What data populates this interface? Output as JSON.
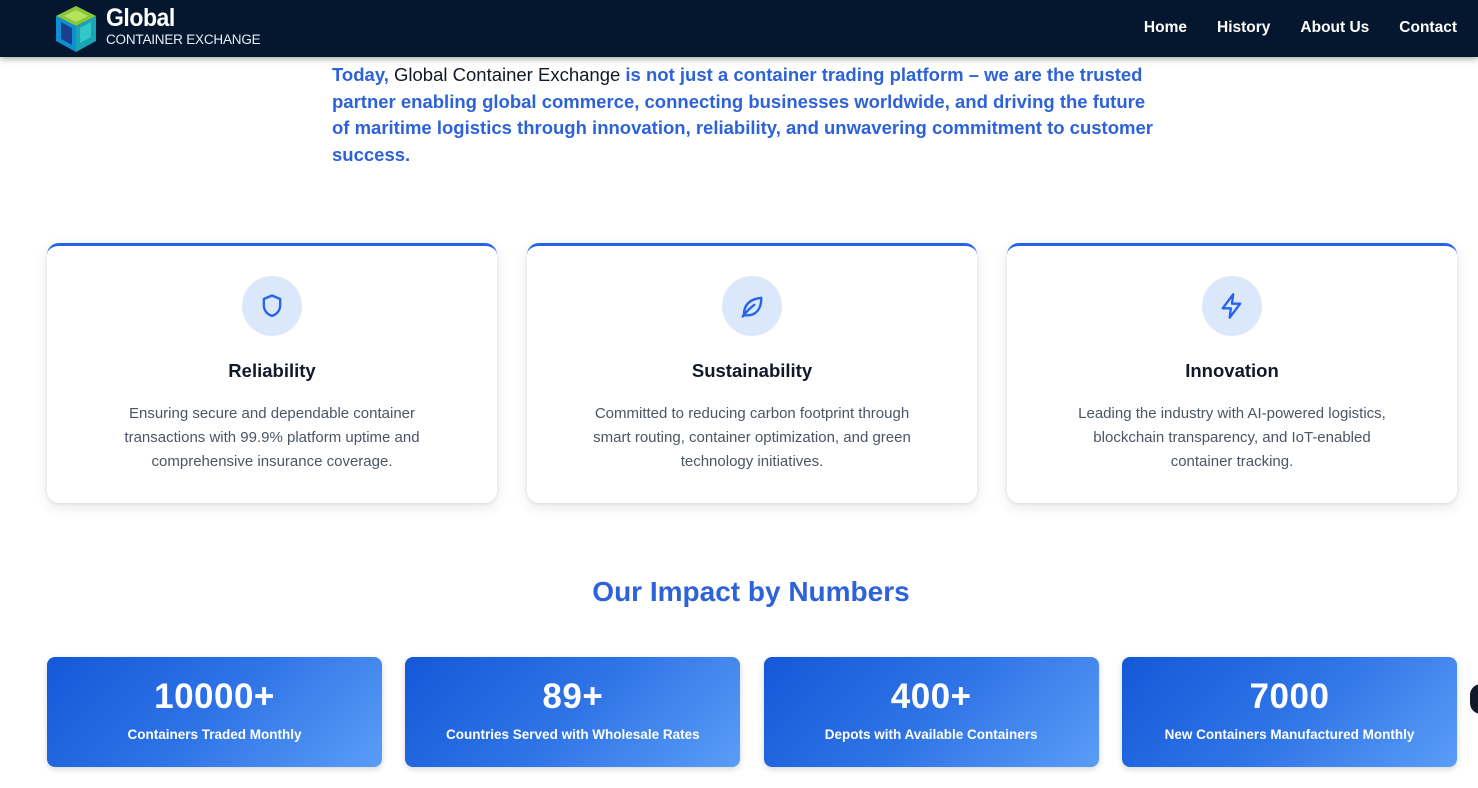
{
  "header": {
    "logo_title": "Global",
    "logo_subtitle": "CONTAINER EXCHANGE",
    "nav": [
      "Home",
      "History",
      "About Us",
      "Contact"
    ]
  },
  "intro": {
    "lead": "Today, ",
    "brand": "Global Container Exchange",
    "rest": " is not just a container trading platform – we are the trusted partner enabling global commerce, connecting businesses worldwide, and driving the future of maritime logistics through innovation, reliability, and unwavering commitment to customer success."
  },
  "values": [
    {
      "icon": "shield-icon",
      "title": "Reliability",
      "desc": "Ensuring secure and dependable container transactions with 99.9% platform uptime and comprehensive insurance coverage."
    },
    {
      "icon": "leaf-icon",
      "title": "Sustainability",
      "desc": "Committed to reducing carbon footprint through smart routing, container optimization, and green technology initiatives."
    },
    {
      "icon": "lightning-icon",
      "title": "Innovation",
      "desc": "Leading the industry with AI-powered logistics, blockchain transparency, and IoT-enabled container tracking."
    }
  ],
  "impact": {
    "title": "Our Impact by Numbers",
    "stats": [
      {
        "number": "10000+",
        "label": "Containers Traded Monthly"
      },
      {
        "number": "89+",
        "label": "Countries Served with Wholesale Rates"
      },
      {
        "number": "400+",
        "label": "Depots with Available Containers"
      },
      {
        "number": "7000",
        "label": "New Containers Manufactured Monthly"
      }
    ]
  },
  "colors": {
    "header_bg": "#04172f",
    "accent": "#2563eb",
    "intro_text": "#2d62d8",
    "icon_bg": "#dbe7fb"
  }
}
